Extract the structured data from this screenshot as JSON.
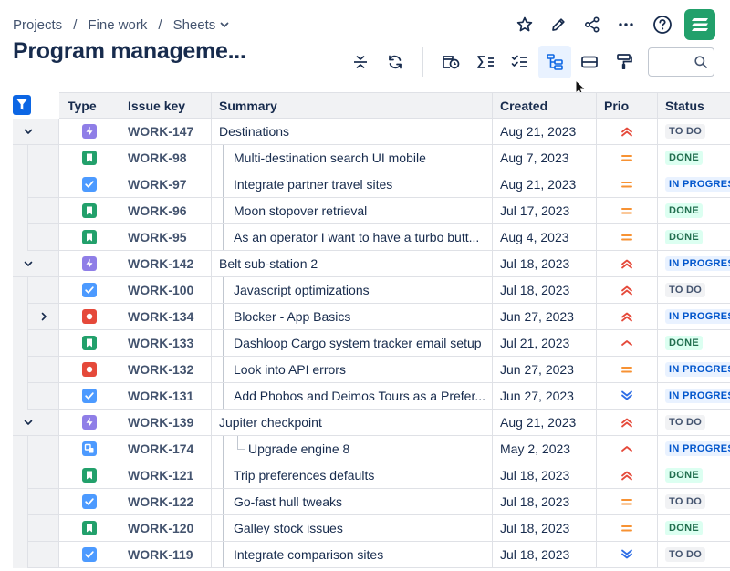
{
  "breadcrumb": {
    "items": [
      "Projects",
      "Fine work",
      "Sheets"
    ],
    "separator": "/"
  },
  "page": {
    "title": "Program manageme..."
  },
  "colors": {
    "accent": "#0c66e4",
    "logo": "#22a06b",
    "epic": "#8f7ee7",
    "story": "#22a06b",
    "task": "#4c9aff",
    "bug": "#e5493a",
    "subtask": "#4c9aff",
    "prio_high": "#e5493a",
    "prio_medium": "#f79233",
    "prio_low": "#2d6de6"
  },
  "icons": {
    "top": [
      "star-icon",
      "pencil-icon",
      "share-icon",
      "more-icon",
      "help-icon"
    ],
    "toolbar": [
      "collapse-rows-icon",
      "refresh-icon",
      "filter-date-icon",
      "sum-icon",
      "checklist-icon",
      "hierarchy-icon",
      "row-height-icon",
      "format-paint-icon"
    ]
  },
  "search": {
    "placeholder": "",
    "value": ""
  },
  "table": {
    "headers": {
      "type": "Type",
      "key": "Issue key",
      "summary": "Summary",
      "created": "Created",
      "prio": "Prio",
      "status": "Status"
    },
    "rows": [
      {
        "level": 0,
        "expander": "down",
        "type": "epic",
        "key": "WORK-147",
        "summary": "Destinations",
        "created": "Aug 21, 2023",
        "prio": "high",
        "status": "TO DO",
        "status_kind": "todo"
      },
      {
        "level": 1,
        "expander": "",
        "type": "story",
        "key": "WORK-98",
        "summary": "Multi-destination search UI mobile",
        "created": "Aug 7, 2023",
        "prio": "medium",
        "status": "DONE",
        "status_kind": "done"
      },
      {
        "level": 1,
        "expander": "",
        "type": "task",
        "key": "WORK-97",
        "summary": "Integrate partner travel sites",
        "created": "Aug 21, 2023",
        "prio": "medium",
        "status": "IN PROGRESS",
        "status_kind": "prog"
      },
      {
        "level": 1,
        "expander": "",
        "type": "story",
        "key": "WORK-96",
        "summary": "Moon stopover retrieval",
        "created": "Jul 17, 2023",
        "prio": "medium",
        "status": "DONE",
        "status_kind": "done"
      },
      {
        "level": 1,
        "expander": "",
        "type": "story",
        "key": "WORK-95",
        "summary": "As an operator I want to have a turbo butt...",
        "created": "Aug 4, 2023",
        "prio": "medium",
        "status": "DONE",
        "status_kind": "done"
      },
      {
        "level": 0,
        "expander": "down",
        "type": "epic",
        "key": "WORK-142",
        "summary": "Belt sub-station 2",
        "created": "Jul 18, 2023",
        "prio": "high",
        "status": "IN PROGRESS",
        "status_kind": "prog"
      },
      {
        "level": 1,
        "expander": "",
        "type": "task",
        "key": "WORK-100",
        "summary": "Javascript optimizations",
        "created": "Jul 18, 2023",
        "prio": "high",
        "status": "TO DO",
        "status_kind": "todo"
      },
      {
        "level": 1,
        "expander": "right",
        "type": "bug",
        "key": "WORK-134",
        "summary": "Blocker - App Basics",
        "created": "Jun 27, 2023",
        "prio": "high",
        "status": "IN PROGRESS",
        "status_kind": "prog"
      },
      {
        "level": 1,
        "expander": "",
        "type": "story",
        "key": "WORK-133",
        "summary": "Dashloop Cargo system tracker email setup",
        "created": "Jul 21, 2023",
        "prio": "high-single",
        "status": "DONE",
        "status_kind": "done"
      },
      {
        "level": 1,
        "expander": "",
        "type": "bug",
        "key": "WORK-132",
        "summary": "Look into API errors",
        "created": "Jun 27, 2023",
        "prio": "medium",
        "status": "IN PROGRESS",
        "status_kind": "prog"
      },
      {
        "level": 1,
        "expander": "",
        "type": "task",
        "key": "WORK-131",
        "summary": "Add Phobos and Deimos Tours as a Prefer...",
        "created": "Jun 27, 2023",
        "prio": "low",
        "status": "IN PROGRESS",
        "status_kind": "prog"
      },
      {
        "level": 0,
        "expander": "down",
        "type": "epic",
        "key": "WORK-139",
        "summary": "Jupiter checkpoint",
        "created": "Aug 21, 2023",
        "prio": "high",
        "status": "TO DO",
        "status_kind": "todo"
      },
      {
        "level": 2,
        "expander": "",
        "type": "subtask",
        "key": "WORK-174",
        "summary": "Upgrade engine 8",
        "created": "May 2, 2023",
        "prio": "high-single",
        "status": "IN PROGRESS",
        "status_kind": "prog"
      },
      {
        "level": 1,
        "expander": "",
        "type": "story",
        "key": "WORK-121",
        "summary": "Trip preferences defaults",
        "created": "Jul 18, 2023",
        "prio": "high",
        "status": "DONE",
        "status_kind": "done"
      },
      {
        "level": 1,
        "expander": "",
        "type": "task",
        "key": "WORK-122",
        "summary": "Go-fast hull tweaks",
        "created": "Jul 18, 2023",
        "prio": "medium",
        "status": "TO DO",
        "status_kind": "todo"
      },
      {
        "level": 1,
        "expander": "",
        "type": "story",
        "key": "WORK-120",
        "summary": "Galley stock issues",
        "created": "Jul 18, 2023",
        "prio": "medium",
        "status": "DONE",
        "status_kind": "done"
      },
      {
        "level": 1,
        "expander": "",
        "type": "task",
        "key": "WORK-119",
        "summary": "Integrate comparison sites",
        "created": "Jul 18, 2023",
        "prio": "low",
        "status": "TO DO",
        "status_kind": "todo"
      }
    ]
  }
}
